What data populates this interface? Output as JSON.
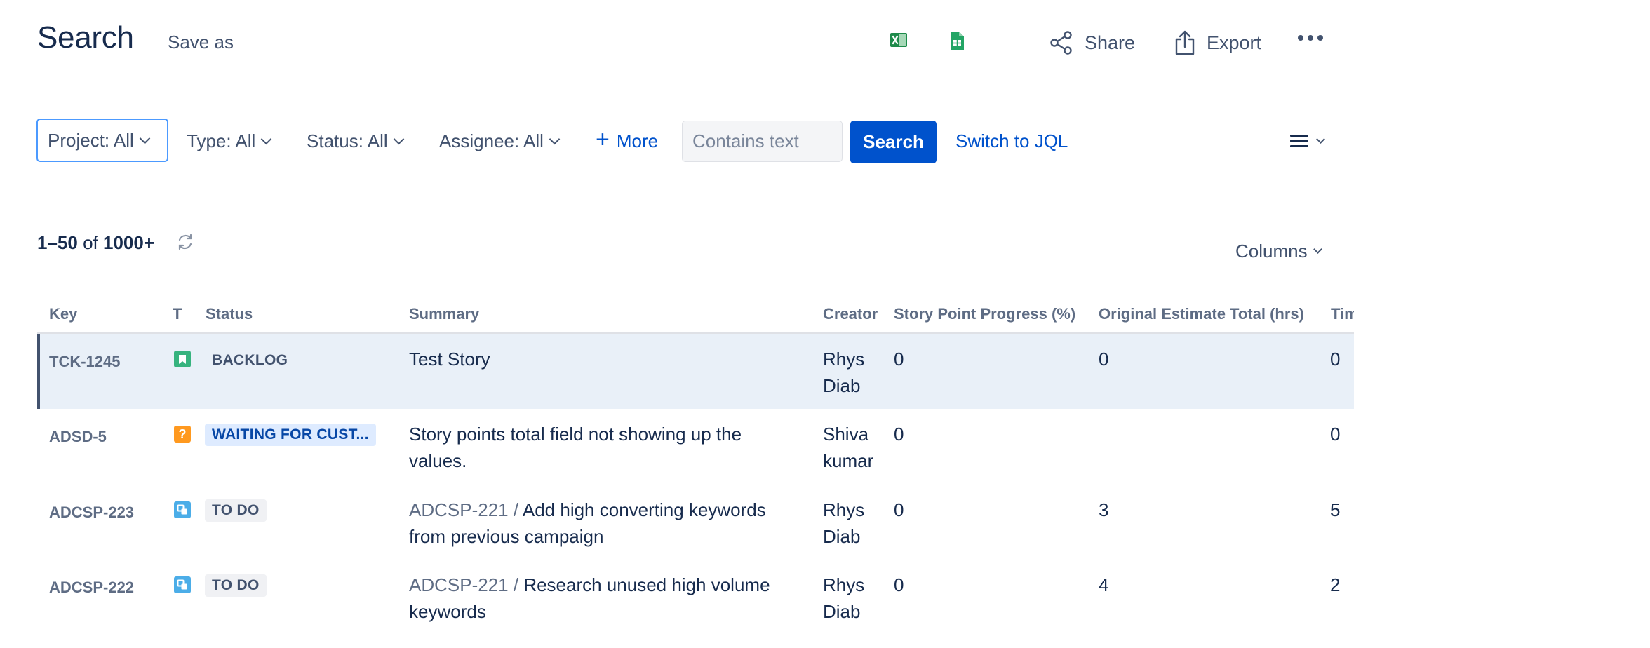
{
  "header": {
    "title": "Search",
    "save_as": "Save as",
    "share": "Share",
    "export": "Export",
    "icons": [
      "excel-icon",
      "google-sheets-icon",
      "share-icon",
      "export-icon",
      "more-icon"
    ]
  },
  "filters": {
    "project": "Project: All",
    "type": "Type: All",
    "status": "Status: All",
    "assignee": "Assignee: All",
    "more": "More",
    "search_placeholder": "Contains text",
    "search_button": "Search",
    "switch_jql": "Switch to JQL"
  },
  "results": {
    "range": "1–50",
    "of_word": "of",
    "total": "1000+",
    "columns_label": "Columns"
  },
  "table": {
    "headers": {
      "key": "Key",
      "type": "T",
      "status": "Status",
      "summary": "Summary",
      "creator": "Creator",
      "story_point_progress": "Story Point Progress (%)",
      "original_estimate": "Original Estimate Total (hrs)",
      "time": "Tim"
    },
    "rows": [
      {
        "key": "TCK-1245",
        "type_icon": "story-icon",
        "status": "BACKLOG",
        "parent": "",
        "summary": "Test Story",
        "creator_line1": "Rhys",
        "creator_line2": "Diab",
        "story_point_progress": "0",
        "original_estimate": "0",
        "time": "0"
      },
      {
        "key": "ADSD-5",
        "type_icon": "question-icon",
        "status": "WAITING FOR CUST...",
        "parent": "",
        "summary": "Story points total field not showing up the values.",
        "creator_line1": "Shiva",
        "creator_line2": "kumar",
        "story_point_progress": "0",
        "original_estimate": "",
        "time": "0"
      },
      {
        "key": "ADCSP-223",
        "type_icon": "subtask-icon",
        "status": "TO DO",
        "parent": "ADCSP-221 /",
        "summary": "Add high converting keywords from previous campaign",
        "creator_line1": "Rhys",
        "creator_line2": "Diab",
        "story_point_progress": "0",
        "original_estimate": "3",
        "time": "5"
      },
      {
        "key": "ADCSP-222",
        "type_icon": "subtask-icon",
        "status": "TO DO",
        "parent": "ADCSP-221 /",
        "summary": "Research unused high volume keywords",
        "creator_line1": "Rhys",
        "creator_line2": "Diab",
        "story_point_progress": "0",
        "original_estimate": "4",
        "time": "2"
      }
    ]
  },
  "colors": {
    "primary": "#0052cc",
    "selected_row": "#e9f0f8",
    "story": "#36b37e",
    "question": "#ff991f",
    "subtask": "#4bade8"
  }
}
